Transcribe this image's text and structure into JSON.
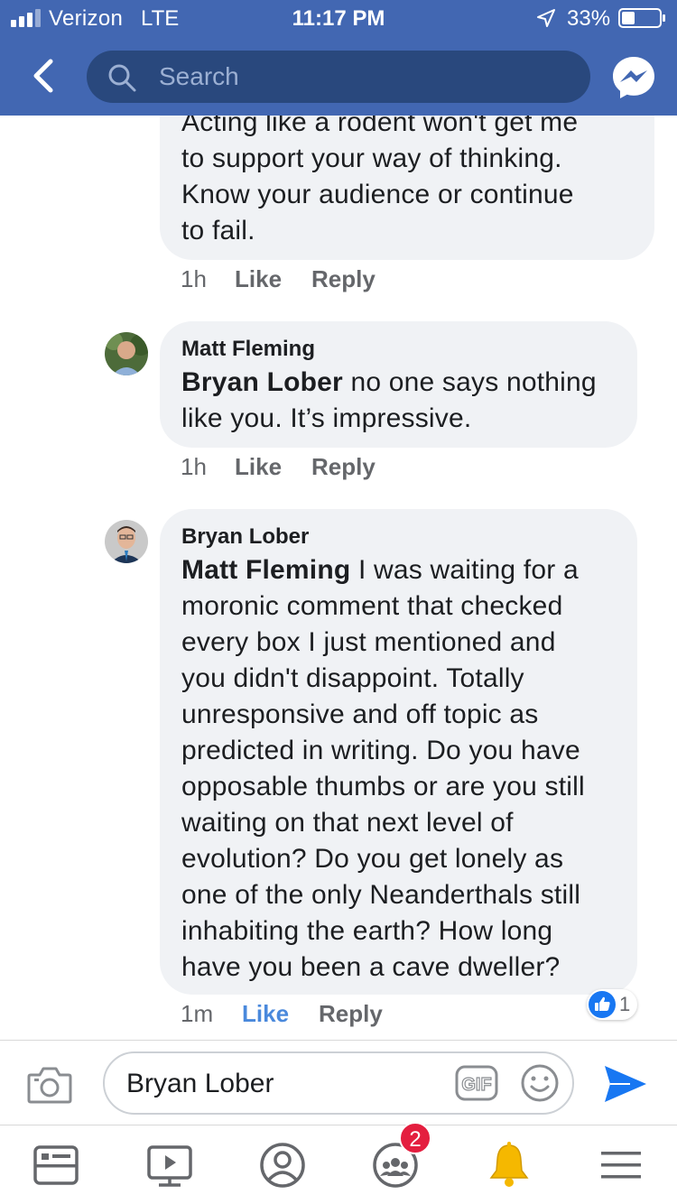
{
  "status_bar": {
    "carrier": "Verizon",
    "network": "LTE",
    "time": "11:17 PM",
    "battery": "33%"
  },
  "nav": {
    "search_placeholder": "Search"
  },
  "comments": [
    {
      "author": "",
      "mention": "",
      "lines": [
        "Acting like a rodent won't get me",
        "to support your way of thinking.",
        "Know your audience or continue",
        "to fail."
      ],
      "time": "1h",
      "like_label": "Like",
      "reply_label": "Reply",
      "liked": false
    },
    {
      "author": "Matt Fleming",
      "mention": "Bryan Lober",
      "lines": [
        " no one says nothing",
        "like you. It’s impressive."
      ],
      "time": "1h",
      "like_label": "Like",
      "reply_label": "Reply",
      "liked": false
    },
    {
      "author": "Bryan Lober",
      "mention": "Matt Fleming",
      "lines": [
        " I was waiting for a",
        "moronic comment that checked",
        "every box I just mentioned and",
        "you didn't disappoint. Totally",
        "unresponsive and off topic as",
        "predicted in writing. Do you have",
        "opposable thumbs or are you still",
        "waiting on that next level of",
        "evolution? Do you get lonely as",
        "one of the only Neanderthals still",
        "inhabiting the earth? How long",
        "have you been a cave dweller?"
      ],
      "time": "1m",
      "like_label": "Like",
      "reply_label": "Reply",
      "liked": true,
      "reaction_count": "1"
    }
  ],
  "composer": {
    "text": "Bryan Lober",
    "gif_label": "GIF"
  },
  "tabbar": {
    "groups_badge": "2"
  },
  "colors": {
    "brand": "#4267b2",
    "bubble": "#f0f2f5",
    "like_active": "#4a89dc",
    "send": "#1877f2",
    "notification": "#e41e3f"
  }
}
